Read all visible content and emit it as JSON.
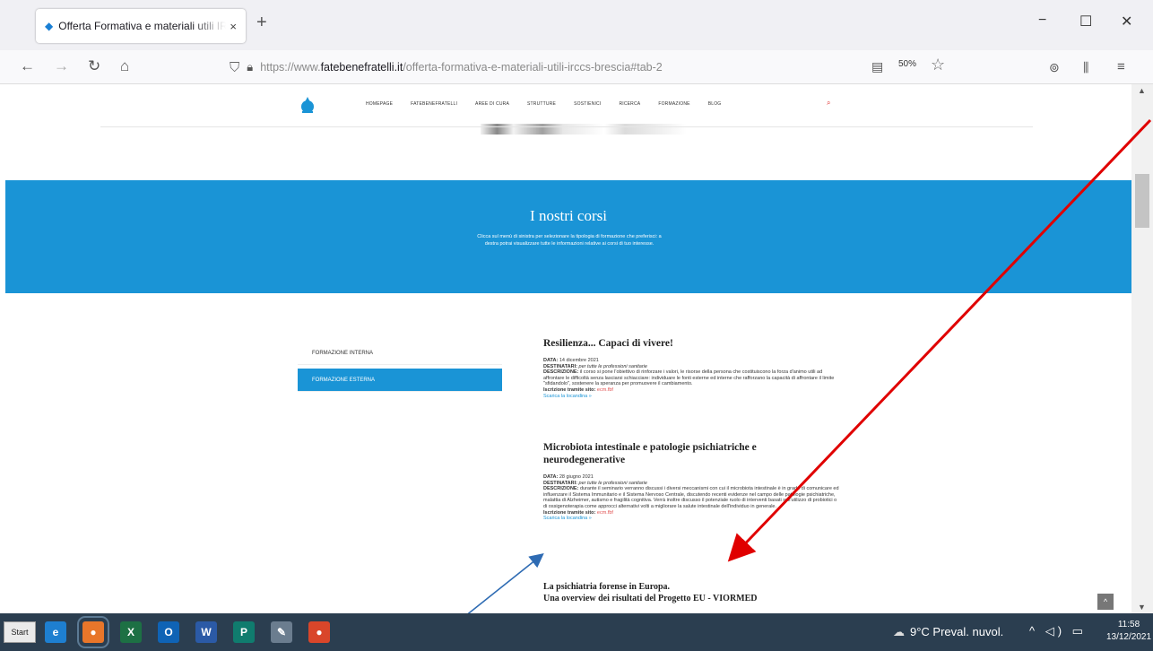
{
  "browser": {
    "tab_title": "Offerta Formativa e materiali utili IRCCS",
    "tab_close": "×",
    "new_tab": "+",
    "window_minimize": "−",
    "window_maximize": "☐",
    "window_close": "✕",
    "back": "←",
    "forward": "→",
    "reload": "↻",
    "home": "⌂",
    "url_prefix": "https://www.",
    "url_domain": "fatebenefratelli.it",
    "url_path": "/offerta-formativa-e-materiali-utili-irccs-brescia#tab-2",
    "zoom": "50%",
    "toolbar_pocket": "⊚",
    "toolbar_library": "⫼",
    "toolbar_menu": "≡",
    "accent_color": "#1a7fd4"
  },
  "site": {
    "menu": [
      "Homepage",
      "Fatebenefratelli",
      "Aree di cura",
      "Strutture",
      "Sostienici",
      "Ricerca",
      "Formazione",
      "Blog"
    ],
    "banner": {
      "title": "I nostri corsi",
      "text": "Clicca sul menù di sinistra per selezionare la tipologia di formazione che preferisci: a destra potrai visualizzare tutte le informazioni relative ai corsi di tuo interesse."
    },
    "sidebar": [
      {
        "label": "Formazione interna",
        "active": false
      },
      {
        "label": "Formazione esterna",
        "active": true
      }
    ],
    "courses": [
      {
        "title": "Resilienza... Capaci di vivere!",
        "date_label": "DATA:",
        "date": "14 dicembre 2021",
        "recipients_label": "DESTINATARI:",
        "recipients": "per tutte le professioni sanitarie",
        "description_label": "DESCRIZIONE:",
        "description": "il corso si pone l'obiettivo di rinforzare i valori, le risorse della persona che costituiscono la forza d'animo utili ad affrontare le difficoltà senza lasciarsi schiacciare: individuare le fonti esterne ed interne che rafforzano la capacità di affrontare il limite \"sfidandolo\", sostenere la speranza per promuovere il cambiamento.",
        "signup_label": "Iscrizione tramite sito:",
        "signup_link": "ecm.fbf",
        "download": "Scarica la locandina »"
      },
      {
        "title": "Microbiota intestinale e patologie psichiatriche e neurodegenerative",
        "date_label": "DATA:",
        "date": "28 giugno 2021",
        "recipients_label": "DESTINATARI:",
        "recipients": "per tutte le professioni sanitarie",
        "description_label": "DESCRIZIONE:",
        "description": "durante il seminario verranno discussi i diversi meccanismi con cui il microbiota intestinale è in grado di comunicare ed influenzare il Sistema Immunitario e il Sistema Nervoso Centrale, discutendo recenti evidenze nel campo delle patologie psichiatriche, malattia di Alzheimer, autismo e fragilità cognitiva. Verrà inoltre discusso il potenziale ruolo di interventi basati sull'utilizzo di probiotici o di ossigenoterapia come approcci alternativi volti a migliorare la salute intestinale dell'individuo in generale.",
        "signup_label": "Iscrizione tramite sito:",
        "signup_link": "ecm.fbf",
        "download": "Scarica la locandina »"
      }
    ],
    "next_course": {
      "line1": "La psichiatria forense in Europa.",
      "line2": "Una overview dei risultati del Progetto EU - VIORMED"
    },
    "back_to_top": "^",
    "primary_color": "#1a94d6"
  },
  "taskbar": {
    "start_label": "Start",
    "apps": [
      {
        "name": "internet-explorer",
        "glyph": "e",
        "color": "#1e7fd0"
      },
      {
        "name": "firefox",
        "glyph": "●",
        "color": "#e8762a"
      },
      {
        "name": "excel",
        "glyph": "X",
        "color": "#1d7044"
      },
      {
        "name": "outlook",
        "glyph": "O",
        "color": "#0f63b5"
      },
      {
        "name": "word",
        "glyph": "W",
        "color": "#2b5aa6"
      },
      {
        "name": "publisher",
        "glyph": "P",
        "color": "#107c6e"
      },
      {
        "name": "paint",
        "glyph": "✎",
        "color": "#6b7d8f"
      },
      {
        "name": "media-app",
        "glyph": "●",
        "color": "#d9462a"
      }
    ],
    "weather": "9°C Preval. nuvol.",
    "tray": "^ ◁) ▭",
    "time": "11:58",
    "date": "13/12/2021"
  }
}
